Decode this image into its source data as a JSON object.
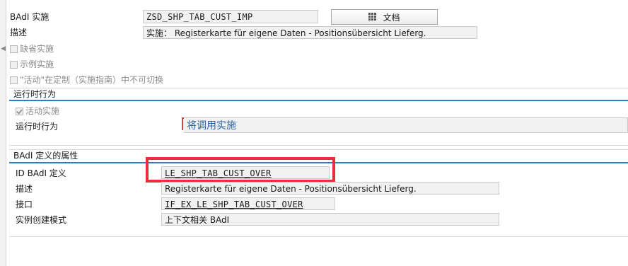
{
  "header": {
    "badi_impl_label": "BAdI 实施",
    "badi_impl_value": "ZSD_SHP_TAB_CUST_IMP",
    "doc_button_label": "文档",
    "desc_label": "描述",
    "desc_value": "实施： Registerkarte für eigene Daten - Positionsübersicht Lieferg."
  },
  "options": {
    "default_impl": "缺省实施",
    "example_impl": "示例实施",
    "active_not_switchable": "\"活动\"在定制（实施指南）中不可切换"
  },
  "runtime": {
    "section_title": "运行时行为",
    "active_impl_label": "活动实施",
    "runtime_behavior_label": "运行时行为",
    "runtime_behavior_value": "将调用实施"
  },
  "badi_def": {
    "section_title": "BAdI 定义的属性",
    "id_label": "ID BAdI 定义",
    "id_value": "LE_SHP_TAB_CUST_OVER",
    "desc_label": "描述",
    "desc_value": "Registerkarte für eigene Daten - Positionsübersicht Lieferg.",
    "interface_label": "接口",
    "interface_value": "IF_EX_LE_SHP_TAB_CUST_OVER",
    "instance_mode_label": "实例创建模式",
    "instance_mode_value": "上下文相关 BAdI"
  },
  "colors": {
    "highlight": "#e8303a",
    "section_line": "#2a7fc9",
    "field_bg": "#f1f1f1"
  },
  "icons": {
    "doc_button_icon": "grid-icon",
    "active_impl_check": "checkbox-checked-icon"
  }
}
